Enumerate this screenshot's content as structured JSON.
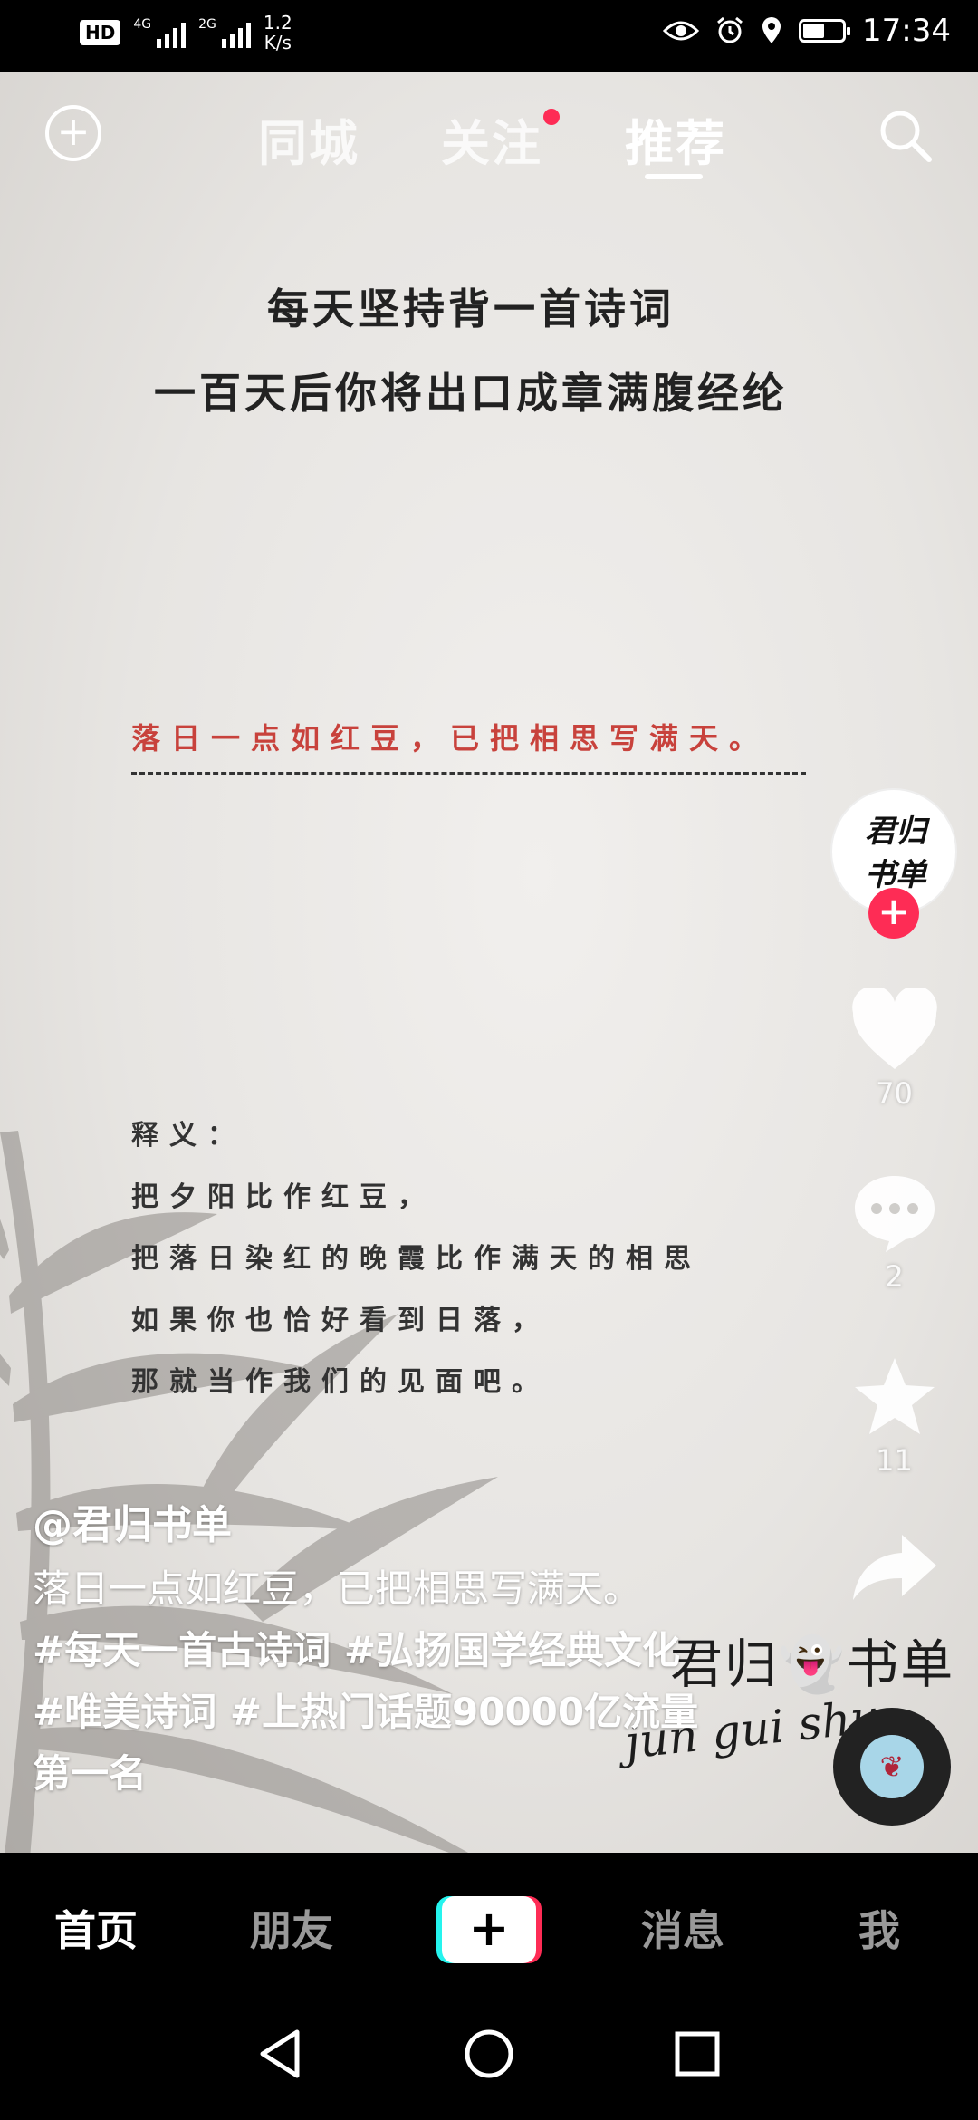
{
  "status_bar": {
    "hd": "HD",
    "sim1": "4G",
    "sim2": "2G",
    "speed_value": "1.2",
    "speed_unit": "K/s",
    "time": "17:34",
    "battery_level": 0.55,
    "icons": [
      "eye-icon",
      "alarm-icon",
      "location-icon",
      "battery-icon"
    ]
  },
  "top_nav": {
    "tabs": [
      {
        "label": "同城",
        "active": false
      },
      {
        "label": "关注",
        "active": false,
        "has_dot": true
      },
      {
        "label": "推荐",
        "active": true
      }
    ],
    "add_icon": "plus-circle-icon",
    "search_icon": "search-icon"
  },
  "video": {
    "title_lines": [
      "每天坚持背一首诗词",
      "一百天后你将出口成章满腹经纶"
    ],
    "poem_line": "落日一点如红豆，已把相思写满天。",
    "explain_lines": [
      "释义：",
      "把夕阳比作红豆，",
      "把落日染红的晚霞比作满天的相思",
      "如果你也恰好看到日落，",
      "那就当作我们的见面吧。"
    ],
    "watermark": "君归👻书单",
    "watermark_signature": "jun gui shu",
    "avatar_text_line1": "君归",
    "avatar_text_line2": "书单"
  },
  "right_rail": {
    "likes": "70",
    "comments": "2",
    "favorites": "11",
    "shares": ""
  },
  "caption": {
    "author": "@君归书单",
    "description": "落日一点如红豆，已把相思写满天。",
    "hashtags": "#每天一首古诗词 #弘扬国学经典文化 #唯美诗词 #上热门话题90000亿流量第一名"
  },
  "tab_bar": {
    "items": [
      {
        "label": "首页",
        "active": true
      },
      {
        "label": "朋友",
        "active": false
      },
      {
        "label": "+",
        "active": false
      },
      {
        "label": "消息",
        "active": false
      },
      {
        "label": "我",
        "active": false
      }
    ]
  },
  "colors": {
    "accent_red": "#fe2c55",
    "accent_cyan": "#25f4ee",
    "poem_red": "#c8423c"
  }
}
